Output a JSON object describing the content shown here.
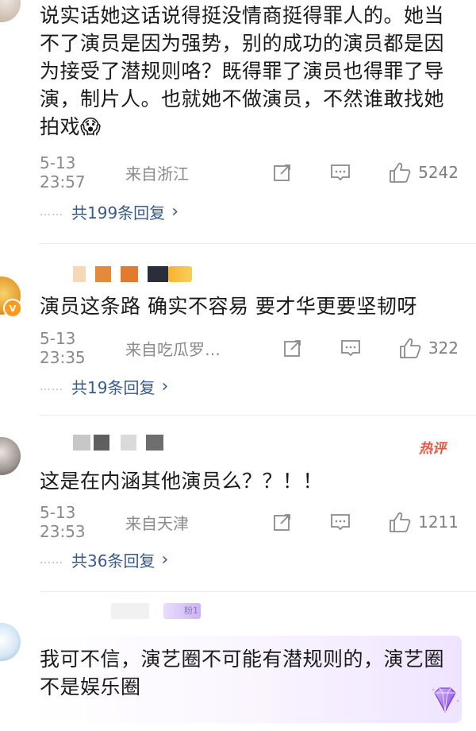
{
  "comments": [
    {
      "text": "说实话她这话说得挺没情商挺得罪人的。她当不了演员是因为强势，别的成功的演员都是因为接受了潜规则咯？既得罪了演员也得罪了导演，制片人。也就她不做演员，不然谁敢找她拍戏😱",
      "time": "5-13 23:57",
      "from": "来自浙江",
      "likes": "5242",
      "replies": "共199条回复"
    },
    {
      "text": "演员这条路 确实不容易 要才华更要坚韧呀",
      "time": "5-13 23:35",
      "from": "来自吃瓜罗…",
      "likes": "322",
      "replies": "共19条回复"
    },
    {
      "text": "这是在内涵其他演员么？？！！",
      "time": "5-13 23:53",
      "from": "来自天津",
      "likes": "1211",
      "replies": "共36条回复",
      "tag": "热评"
    },
    {
      "text": "我可不信，演艺圈不可能有潜规则的，演艺圈不是娱乐圈",
      "fan_badge": "粉1"
    }
  ],
  "colors": {
    "link": "#3a5a8a",
    "meta": "#8a8a8a",
    "hot": "#e8563f",
    "vip": "#ff9a1f"
  },
  "icons": [
    "repost-icon",
    "comment-icon",
    "like-icon",
    "chevron-right-icon",
    "verified-badge-icon",
    "diamond-icon"
  ]
}
